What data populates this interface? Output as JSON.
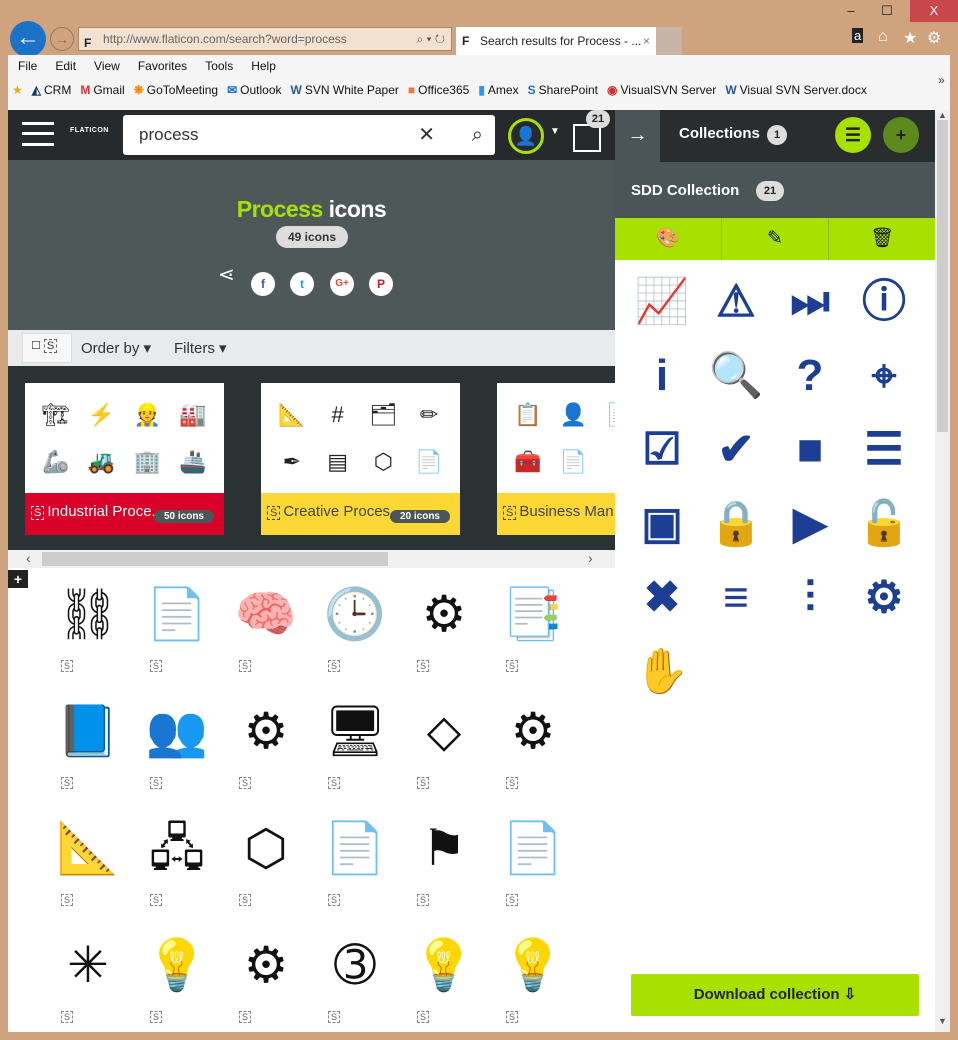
{
  "window": {
    "min": "‒",
    "max": "☐",
    "close": "X"
  },
  "browser": {
    "url": "http://www.flaticon.com/search?word=process",
    "tab_title": "Search results for Process - ...",
    "menu": [
      "File",
      "Edit",
      "View",
      "Favorites",
      "Tools",
      "Help"
    ],
    "favorites": [
      {
        "icon": "◭",
        "label": "CRM"
      },
      {
        "icon": "M",
        "label": "Gmail"
      },
      {
        "icon": "❋",
        "label": "GoToMeeting"
      },
      {
        "icon": "✉",
        "label": "Outlook"
      },
      {
        "icon": "W",
        "label": "SVN White Paper"
      },
      {
        "icon": "■",
        "label": "Office365"
      },
      {
        "icon": "▮",
        "label": "Amex"
      },
      {
        "icon": "S",
        "label": "SharePoint"
      },
      {
        "icon": "◉",
        "label": "VisualSVN Server"
      },
      {
        "icon": "W",
        "label": "Visual SVN Server.docx"
      }
    ],
    "more": "»"
  },
  "site": {
    "logo": "FLATICON",
    "search_value": "process",
    "grid_badge": "21",
    "hero": {
      "title_accent": "Process",
      "title_rest": " icons",
      "count": "49 icons"
    },
    "social": [
      "f",
      "t",
      "G+",
      "P"
    ],
    "toolbar": {
      "s": "S",
      "order_by": "Order by ▾",
      "filters": "Filters ▾"
    },
    "packs": [
      {
        "name": "Industrial Proce...",
        "count": "50 icons",
        "color": "#d9002a",
        "icons": [
          "🏗",
          "⚡",
          "👷",
          "🏭",
          "🦾",
          "🚜",
          "🏢",
          "🚢"
        ]
      },
      {
        "name": "Creative Proces...",
        "count": "20 icons",
        "color": "#fdd835",
        "icons": [
          "📐",
          "#",
          "🗂",
          "✏",
          "✒",
          "▤",
          "⬡",
          "📄"
        ]
      },
      {
        "name": "Business Man...",
        "count": "",
        "color": "#fdd835",
        "icons": [
          "📋",
          "👤",
          "📄",
          "📄",
          "🧰",
          "📄"
        ]
      }
    ],
    "results": [
      "⛓",
      "📄",
      "🧠",
      "🕒",
      "⚙",
      "📑",
      "📘",
      "👥",
      "⚙",
      "🖥",
      "⬦",
      "⚙",
      "📐",
      "🖧",
      "⬡",
      "📄",
      "⚑",
      "📄",
      "✳",
      "💡",
      "⚙",
      "➂",
      "💡",
      "💡"
    ]
  },
  "panel": {
    "title": "Collections",
    "count": "1",
    "collection_name": "SDD Collection",
    "collection_count": "21",
    "tools": [
      "🎨",
      "✎",
      "🗑"
    ],
    "icons": [
      "📈",
      "⚠",
      "⏭",
      "ⓘ",
      "i",
      "🔍",
      "?",
      "⌖",
      "☑",
      "✔",
      "■",
      "☰",
      "▣",
      "🔒",
      "▶",
      "🔓",
      "✖",
      "≡",
      "⫶",
      "⚙",
      "✋"
    ],
    "download": "Download collection ⇩"
  },
  "colors": {
    "accent": "#a8e000",
    "icon_blue": "#1c3f94",
    "header": "#262a2c"
  }
}
